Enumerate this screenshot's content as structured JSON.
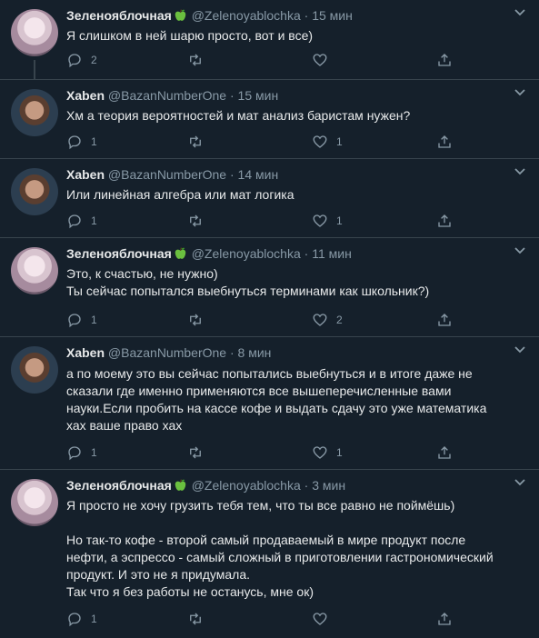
{
  "ui": {
    "more_icon": "more-chevron-icon"
  },
  "tweets": [
    {
      "name": "Зеленояблочная",
      "emoji": "green-apple-icon",
      "handle": "@Zelenoyablochka",
      "dot": "·",
      "time": "15 мин",
      "lines": [
        "Я слишком в ней шарю просто, вот и все)"
      ],
      "reply_count": "2",
      "retweet_count": "",
      "like_count": ""
    },
    {
      "name": "Xaben",
      "handle": "@BazanNumberOne",
      "dot": "·",
      "time": "15 мин",
      "lines": [
        "Хм а теория вероятностей и мат анализ баристам нужен?"
      ],
      "reply_count": "1",
      "retweet_count": "",
      "like_count": "1"
    },
    {
      "name": "Xaben",
      "handle": "@BazanNumberOne",
      "dot": "·",
      "time": "14 мин",
      "lines": [
        "Или линейная алгебра или мат логика"
      ],
      "reply_count": "1",
      "retweet_count": "",
      "like_count": "1"
    },
    {
      "name": "Зеленояблочная",
      "emoji": "green-apple-icon",
      "handle": "@Zelenoyablochka",
      "dot": "·",
      "time": "11 мин",
      "lines": [
        "Это, к счастью, не нужно)",
        "Ты сейчас попытался выебнуться терминами как школьник?)"
      ],
      "reply_count": "1",
      "retweet_count": "",
      "like_count": "2"
    },
    {
      "name": "Xaben",
      "handle": "@BazanNumberOne",
      "dot": "·",
      "time": "8 мин",
      "lines": [
        "а по моему это вы сейчас попытались выебнуться и в итоге даже не",
        "сказали где именно применяются все вышеперечисленные вами",
        "науки.Если пробить на кассе кофе и выдать сдачу это уже математика",
        "хах ваше право хах"
      ],
      "reply_count": "1",
      "retweet_count": "",
      "like_count": "1"
    },
    {
      "name": "Зеленояблочная",
      "emoji": "green-apple-icon",
      "handle": "@Zelenoyablochka",
      "dot": "·",
      "time": "3 мин",
      "lines": [
        "Я просто не хочу грузить тебя тем, что ты все равно не поймёшь)",
        "",
        "Но так-то кофе - второй самый продаваемый в мире продукт после",
        "нефти, а эспрессо - самый сложный в приготовлении гастрономический",
        "продукт. И это не я придумала.",
        "Так что я без работы не останусь, мне ок)"
      ],
      "reply_count": "1",
      "retweet_count": "",
      "like_count": ""
    }
  ]
}
